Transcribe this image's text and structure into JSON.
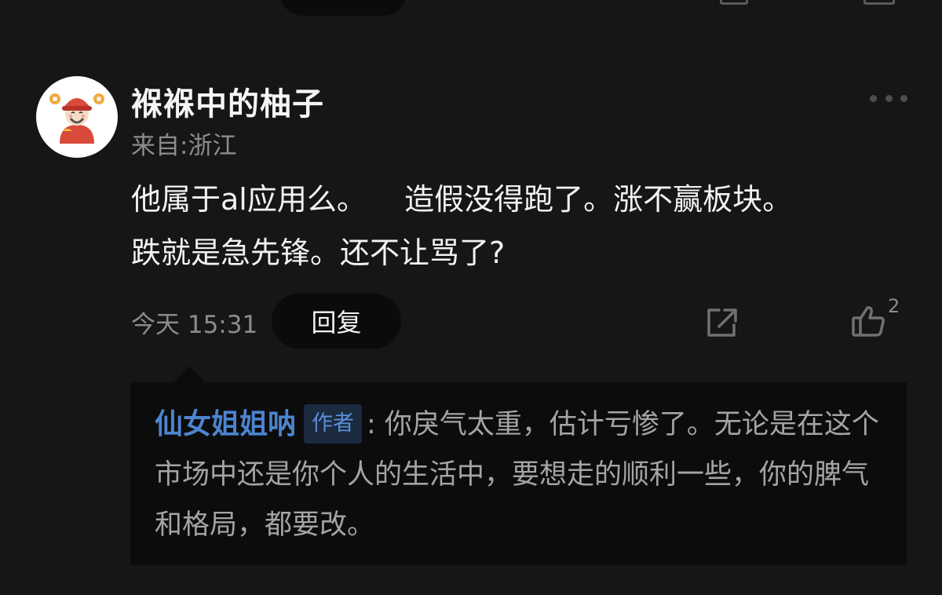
{
  "comment": {
    "username": "褓褓中的柚子",
    "location": "来自:浙江",
    "text": "他属于al应用么。    造假没得跑了。涨不赢板块。\n跌就是急先锋。还不让骂了?",
    "timestamp": "今天 15:31",
    "reply_label": "回复",
    "like_count": "2"
  },
  "reply": {
    "author": "仙女姐姐呐",
    "author_tag": "作者",
    "text": ": 你戾气太重，估计亏惨了。无论是在这个市场中还是你个人的生活中，要想走的顺利一些，你的脾气和格局，都要改。"
  },
  "icons": {
    "avatar": "god-of-wealth-avatar",
    "more": "more-icon",
    "share": "share-icon",
    "like": "thumbs-up-icon"
  },
  "colors": {
    "background": "#161616",
    "author_link": "#4c84cf",
    "reply_background": "#0c0c0c"
  }
}
